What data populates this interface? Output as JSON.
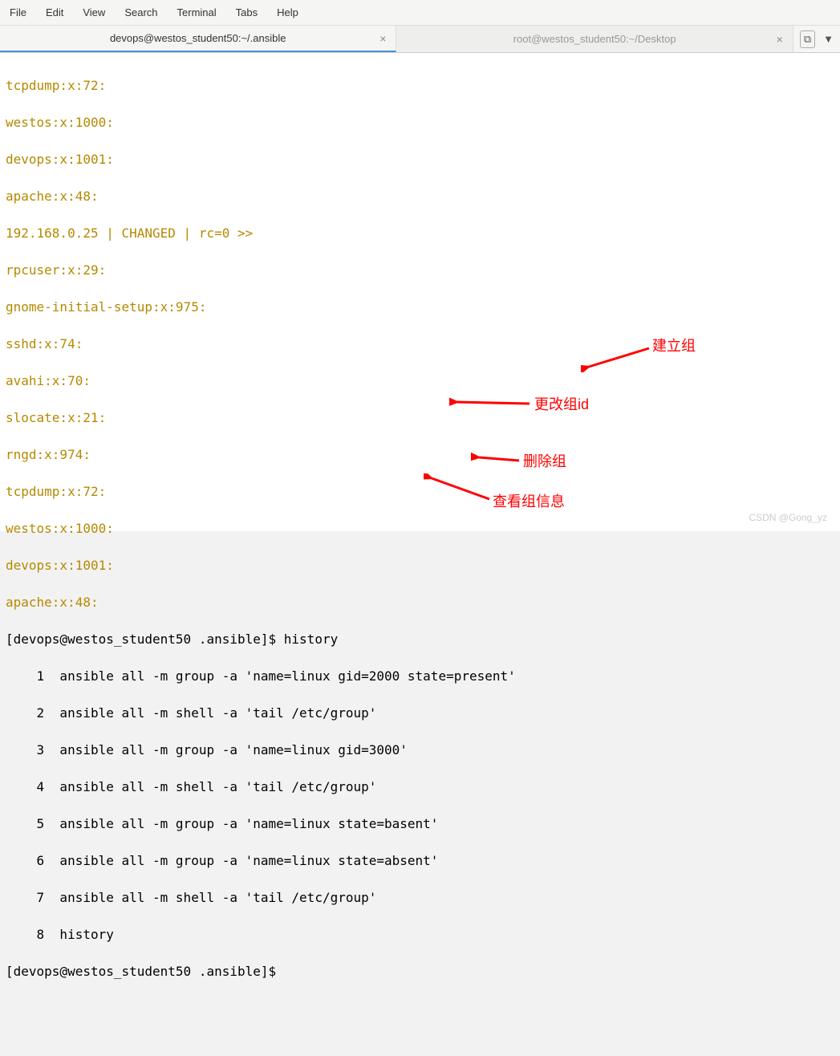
{
  "menubar": {
    "file": "File",
    "edit": "Edit",
    "view": "View",
    "search": "Search",
    "terminal": "Terminal",
    "tabs": "Tabs",
    "help": "Help"
  },
  "tabs": {
    "active": "devops@westos_student50:~/.ansible",
    "inactive": "root@westos_student50:~/Desktop",
    "close": "×"
  },
  "terminal": {
    "l1": "tcpdump:x:72:",
    "l2": "westos:x:1000:",
    "l3": "devops:x:1001:",
    "l4": "apache:x:48:",
    "l5": "192.168.0.25 | CHANGED | rc=0 >>",
    "l6": "rpcuser:x:29:",
    "l7": "gnome-initial-setup:x:975:",
    "l8": "sshd:x:74:",
    "l9": "avahi:x:70:",
    "l10": "slocate:x:21:",
    "l11": "rngd:x:974:",
    "l12": "tcpdump:x:72:",
    "l13": "westos:x:1000:",
    "l14": "devops:x:1001:",
    "l15": "apache:x:48:",
    "prompt1_pre": "[devops@westos_student50 .ansible]$ ",
    "prompt1_cmd": "history",
    "h1": "    1  ansible all -m group -a 'name=linux gid=2000 state=present'",
    "h2": "    2  ansible all -m shell -a 'tail /etc/group'",
    "h3": "    3  ansible all -m group -a 'name=linux gid=3000'",
    "h4": "    4  ansible all -m shell -a 'tail /etc/group'",
    "h5": "    5  ansible all -m group -a 'name=linux state=basent'",
    "h6": "    6  ansible all -m group -a 'name=linux state=absent'",
    "h7": "    7  ansible all -m shell -a 'tail /etc/group'",
    "h8": "    8  history",
    "prompt2": "[devops@westos_student50 .ansible]$"
  },
  "annotations": {
    "a1": "建立组",
    "a2": "更改组id",
    "a3": "删除组",
    "a4": "查看组信息"
  },
  "watermark": "CSDN @Gong_yz"
}
